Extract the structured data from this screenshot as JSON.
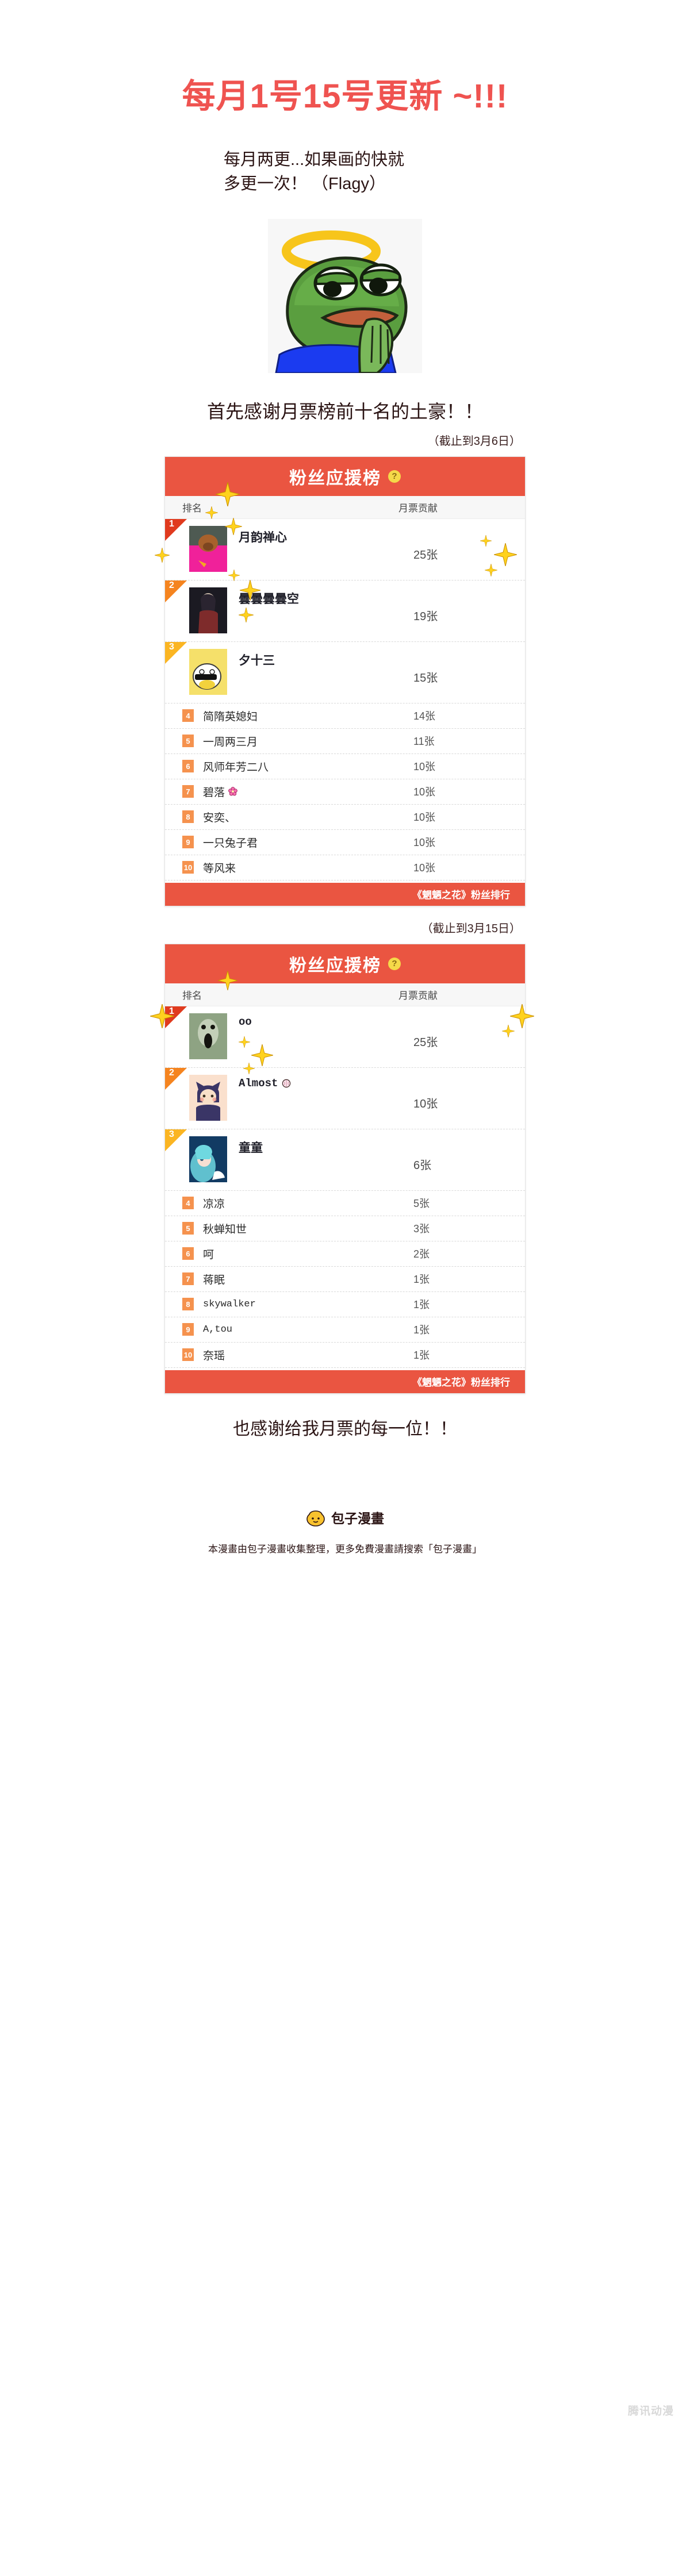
{
  "header": {
    "title": "每月1号15号更新 ~!!!",
    "subtitle_line1": "每月两更...如果画的快就",
    "subtitle_line2": "多更一次！ （Flagy）",
    "title_color": "#ef5350"
  },
  "frog": {
    "alt_name": "pepe-halo-frog"
  },
  "thanks_top": "首先感谢月票榜前十名的土豪！！",
  "thanks_bottom": "也感谢给我月票的每一位！！",
  "cards": [
    {
      "cutoff": "（截止到3月6日）",
      "header_title": "粉丝应援榜",
      "help_icon": "question-mark",
      "columns": {
        "rank": "排名",
        "name": "",
        "votes": "月票贡献"
      },
      "footer": "《魍魉之花》粉丝排行",
      "top_rows": [
        {
          "rank": "1",
          "name": "月韵禅心",
          "votes": "25张",
          "avatar": "pink-poodle"
        },
        {
          "rank": "2",
          "name": "曇曇曇曇空",
          "votes": "19张",
          "avatar": "dark-scarf-girl"
        },
        {
          "rank": "3",
          "name": "夕十三",
          "votes": "15张",
          "avatar": "yellow-sunglasses-duck"
        }
      ],
      "small_rows": [
        {
          "rank": "4",
          "name": "简隋英媳妇",
          "votes": "14张"
        },
        {
          "rank": "5",
          "name": "一周两三月",
          "votes": "11张"
        },
        {
          "rank": "6",
          "name": "风师年芳二八",
          "votes": "10张"
        },
        {
          "rank": "7",
          "name": "碧落",
          "votes": "10张",
          "emoji": "cherry-blossom"
        },
        {
          "rank": "8",
          "name": "安奕、",
          "votes": "10张"
        },
        {
          "rank": "9",
          "name": "一只兔子君",
          "votes": "10张"
        },
        {
          "rank": "10",
          "name": "等风来",
          "votes": "10张"
        }
      ]
    },
    {
      "cutoff": "（截止到3月15日）",
      "header_title": "粉丝应援榜",
      "help_icon": "question-mark",
      "columns": {
        "rank": "排名",
        "name": "",
        "votes": "月票贡献"
      },
      "footer": "《魍魉之花》粉丝排行",
      "top_rows": [
        {
          "rank": "1",
          "name": "oo",
          "votes": "25张",
          "avatar": "green-ghost",
          "mono": true
        },
        {
          "rank": "2",
          "name": "Almost",
          "votes": "10张",
          "avatar": "cat-hoodie-girl",
          "mono": true,
          "emoji": "brain"
        },
        {
          "rank": "3",
          "name": "童童",
          "votes": "6张",
          "avatar": "blue-hair-girl"
        }
      ],
      "small_rows": [
        {
          "rank": "4",
          "name": "凉凉",
          "votes": "5张"
        },
        {
          "rank": "5",
          "name": "秋蝉知世",
          "votes": "3张"
        },
        {
          "rank": "6",
          "name": "呵",
          "votes": "2张"
        },
        {
          "rank": "7",
          "name": "蒋眠",
          "votes": "1张"
        },
        {
          "rank": "8",
          "name": "skywalker",
          "votes": "1张",
          "mono": true
        },
        {
          "rank": "9",
          "name": "A,tou",
          "votes": "1张",
          "mono": true
        },
        {
          "rank": "10",
          "name": "奈瑶",
          "votes": "1张"
        }
      ]
    }
  ],
  "watermark": "腾讯动漫",
  "logo": {
    "name": "包子漫畫",
    "icon": "baozi-bun-icon"
  },
  "bottom_note": "本漫畫由包子漫畫收集整理，更多免費漫畫請搜索「包子漫畫」",
  "colors": {
    "card_red": "#ea5541",
    "rank1": "#e03a1e",
    "rank2": "#f5841f",
    "rank3": "#fbb522",
    "badge": "#f5924e"
  }
}
